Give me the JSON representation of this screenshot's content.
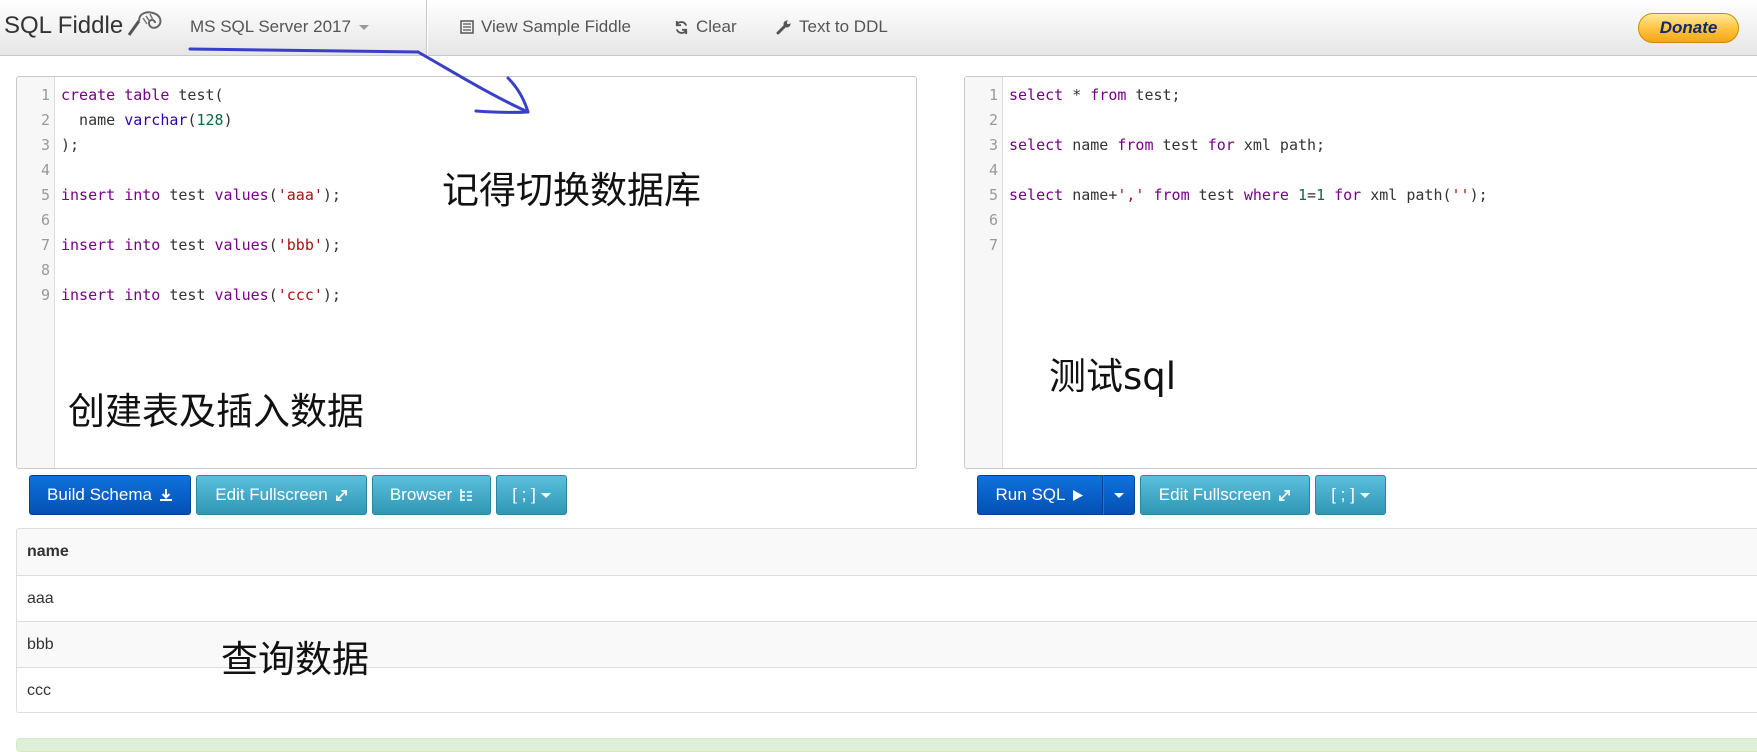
{
  "navbar": {
    "brand": "SQL Fiddle",
    "database": "MS SQL Server 2017",
    "links": [
      {
        "label": "View Sample Fiddle",
        "icon": "list-icon"
      },
      {
        "label": "Clear",
        "icon": "refresh-icon"
      },
      {
        "label": "Text to DDL",
        "icon": "wrench-icon"
      }
    ],
    "donate": "Donate"
  },
  "schema_panel": {
    "lines": [
      {
        "num": "1",
        "tokens": [
          {
            "t": "create",
            "c": "kw"
          },
          {
            "t": " "
          },
          {
            "t": "table",
            "c": "kw"
          },
          {
            "t": " test("
          }
        ]
      },
      {
        "num": "2",
        "tokens": [
          {
            "t": "  name "
          },
          {
            "t": "varchar",
            "c": "ty"
          },
          {
            "t": "("
          },
          {
            "t": "128",
            "c": "num"
          },
          {
            "t": ")"
          }
        ]
      },
      {
        "num": "3",
        "tokens": [
          {
            "t": ");"
          }
        ]
      },
      {
        "num": "4",
        "tokens": []
      },
      {
        "num": "5",
        "tokens": [
          {
            "t": "insert",
            "c": "kw"
          },
          {
            "t": " "
          },
          {
            "t": "into",
            "c": "kw"
          },
          {
            "t": " test "
          },
          {
            "t": "values",
            "c": "kw"
          },
          {
            "t": "("
          },
          {
            "t": "'aaa'",
            "c": "str"
          },
          {
            "t": ");"
          }
        ]
      },
      {
        "num": "6",
        "tokens": []
      },
      {
        "num": "7",
        "tokens": [
          {
            "t": "insert",
            "c": "kw"
          },
          {
            "t": " "
          },
          {
            "t": "into",
            "c": "kw"
          },
          {
            "t": " test "
          },
          {
            "t": "values",
            "c": "kw"
          },
          {
            "t": "("
          },
          {
            "t": "'bbb'",
            "c": "str"
          },
          {
            "t": ");"
          }
        ]
      },
      {
        "num": "8",
        "tokens": []
      },
      {
        "num": "9",
        "tokens": [
          {
            "t": "insert",
            "c": "kw"
          },
          {
            "t": " "
          },
          {
            "t": "into",
            "c": "kw"
          },
          {
            "t": " test "
          },
          {
            "t": "values",
            "c": "kw"
          },
          {
            "t": "("
          },
          {
            "t": "'ccc'",
            "c": "str"
          },
          {
            "t": ");"
          }
        ]
      }
    ],
    "buttons": {
      "build_schema": "Build Schema",
      "edit_fullscreen": "Edit Fullscreen",
      "browser": "Browser",
      "delimiter": "[ ; ]"
    }
  },
  "query_panel": {
    "lines": [
      {
        "num": "1",
        "tokens": [
          {
            "t": "select",
            "c": "kw"
          },
          {
            "t": " * "
          },
          {
            "t": "from",
            "c": "kw"
          },
          {
            "t": " test;"
          }
        ]
      },
      {
        "num": "2",
        "tokens": []
      },
      {
        "num": "3",
        "tokens": [
          {
            "t": "select",
            "c": "kw"
          },
          {
            "t": " name "
          },
          {
            "t": "from",
            "c": "kw"
          },
          {
            "t": " test "
          },
          {
            "t": "for",
            "c": "kw"
          },
          {
            "t": " xml path;"
          }
        ]
      },
      {
        "num": "4",
        "tokens": []
      },
      {
        "num": "5",
        "tokens": [
          {
            "t": "select",
            "c": "kw"
          },
          {
            "t": " name+"
          },
          {
            "t": "','",
            "c": "str"
          },
          {
            "t": " "
          },
          {
            "t": "from",
            "c": "kw"
          },
          {
            "t": " test "
          },
          {
            "t": "where",
            "c": "kw"
          },
          {
            "t": " "
          },
          {
            "t": "1",
            "c": "num"
          },
          {
            "t": "="
          },
          {
            "t": "1",
            "c": "num"
          },
          {
            "t": " "
          },
          {
            "t": "for",
            "c": "kw"
          },
          {
            "t": " xml path("
          },
          {
            "t": "''",
            "c": "str"
          },
          {
            "t": ");"
          }
        ]
      },
      {
        "num": "6",
        "tokens": []
      },
      {
        "num": "7",
        "tokens": []
      }
    ],
    "buttons": {
      "run_sql": "Run SQL",
      "edit_fullscreen": "Edit Fullscreen",
      "delimiter": "[ ; ]"
    }
  },
  "results": {
    "header": "name",
    "rows": [
      "aaa",
      "bbb",
      "ccc"
    ]
  },
  "annotations": {
    "switch_db": "记得切换数据库",
    "create_insert": "创建表及插入数据",
    "test_sql": "测试sql",
    "query_data": "查询数据",
    "ink_color": "#3a3fc8"
  },
  "colors": {
    "keyword": "#770088",
    "type": "#3300aa",
    "string": "#aa1111",
    "number": "#116644",
    "primary_button": "#0450b5",
    "info_button": "#2f96b4"
  }
}
